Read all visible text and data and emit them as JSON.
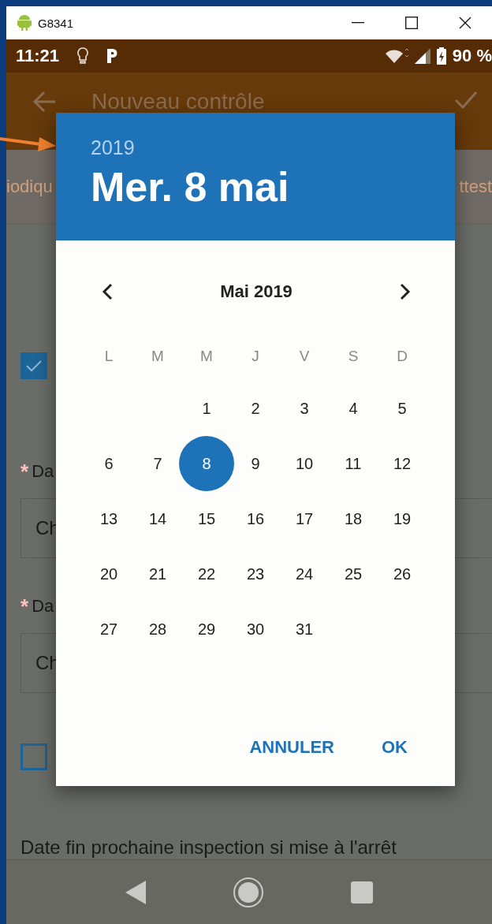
{
  "window": {
    "title": "G8341"
  },
  "status_bar": {
    "time": "11:21",
    "battery": "90 %"
  },
  "app_bar": {
    "title": "Nouveau contrôle"
  },
  "tabs": [
    {
      "label": "iodiqu"
    },
    {
      "label": "ttest"
    }
  ],
  "form": [
    {
      "kind": "checkbox",
      "checked": true
    },
    {
      "kind": "field",
      "required_mark": "*",
      "label": "Da",
      "value": "Ch"
    },
    {
      "kind": "field",
      "required_mark": "*",
      "label": "Da",
      "value": "Ch"
    },
    {
      "kind": "checkbox",
      "checked": false
    },
    {
      "kind": "text",
      "label": "Date fin prochaine inspection si mise à l'arrêt"
    }
  ],
  "date_picker": {
    "year": "2019",
    "date": "Mer. 8 mai",
    "month": "Mai 2019",
    "weekdays": [
      "L",
      "M",
      "M",
      "J",
      "V",
      "S",
      "D"
    ],
    "weeks": [
      [
        {
          "label": "1",
          "selected": false
        },
        {
          "label": "2",
          "selected": false
        },
        {
          "label": "3",
          "selected": false
        },
        {
          "label": "4",
          "selected": false
        },
        {
          "label": "5",
          "selected": false
        }
      ],
      [
        {
          "label": "6",
          "selected": false
        },
        {
          "label": "7",
          "selected": false
        },
        {
          "label": "8",
          "selected": true
        },
        {
          "label": "9",
          "selected": false
        },
        {
          "label": "10",
          "selected": false
        },
        {
          "label": "11",
          "selected": false
        },
        {
          "label": "12",
          "selected": false
        }
      ],
      [
        {
          "label": "13",
          "selected": false
        },
        {
          "label": "14",
          "selected": false
        },
        {
          "label": "15",
          "selected": false
        },
        {
          "label": "16",
          "selected": false
        },
        {
          "label": "17",
          "selected": false
        },
        {
          "label": "18",
          "selected": false
        },
        {
          "label": "19",
          "selected": false
        }
      ],
      [
        {
          "label": "20",
          "selected": false
        },
        {
          "label": "21",
          "selected": false
        },
        {
          "label": "22",
          "selected": false
        },
        {
          "label": "23",
          "selected": false
        },
        {
          "label": "24",
          "selected": false
        },
        {
          "label": "25",
          "selected": false
        },
        {
          "label": "26",
          "selected": false
        }
      ],
      [
        {
          "label": "27",
          "selected": false
        },
        {
          "label": "28",
          "selected": false
        },
        {
          "label": "29",
          "selected": false
        },
        {
          "label": "30",
          "selected": false
        },
        {
          "label": "31",
          "selected": false
        }
      ]
    ],
    "buttons": [
      {
        "label": "ANNULER"
      },
      {
        "label": "OK"
      }
    ]
  }
}
